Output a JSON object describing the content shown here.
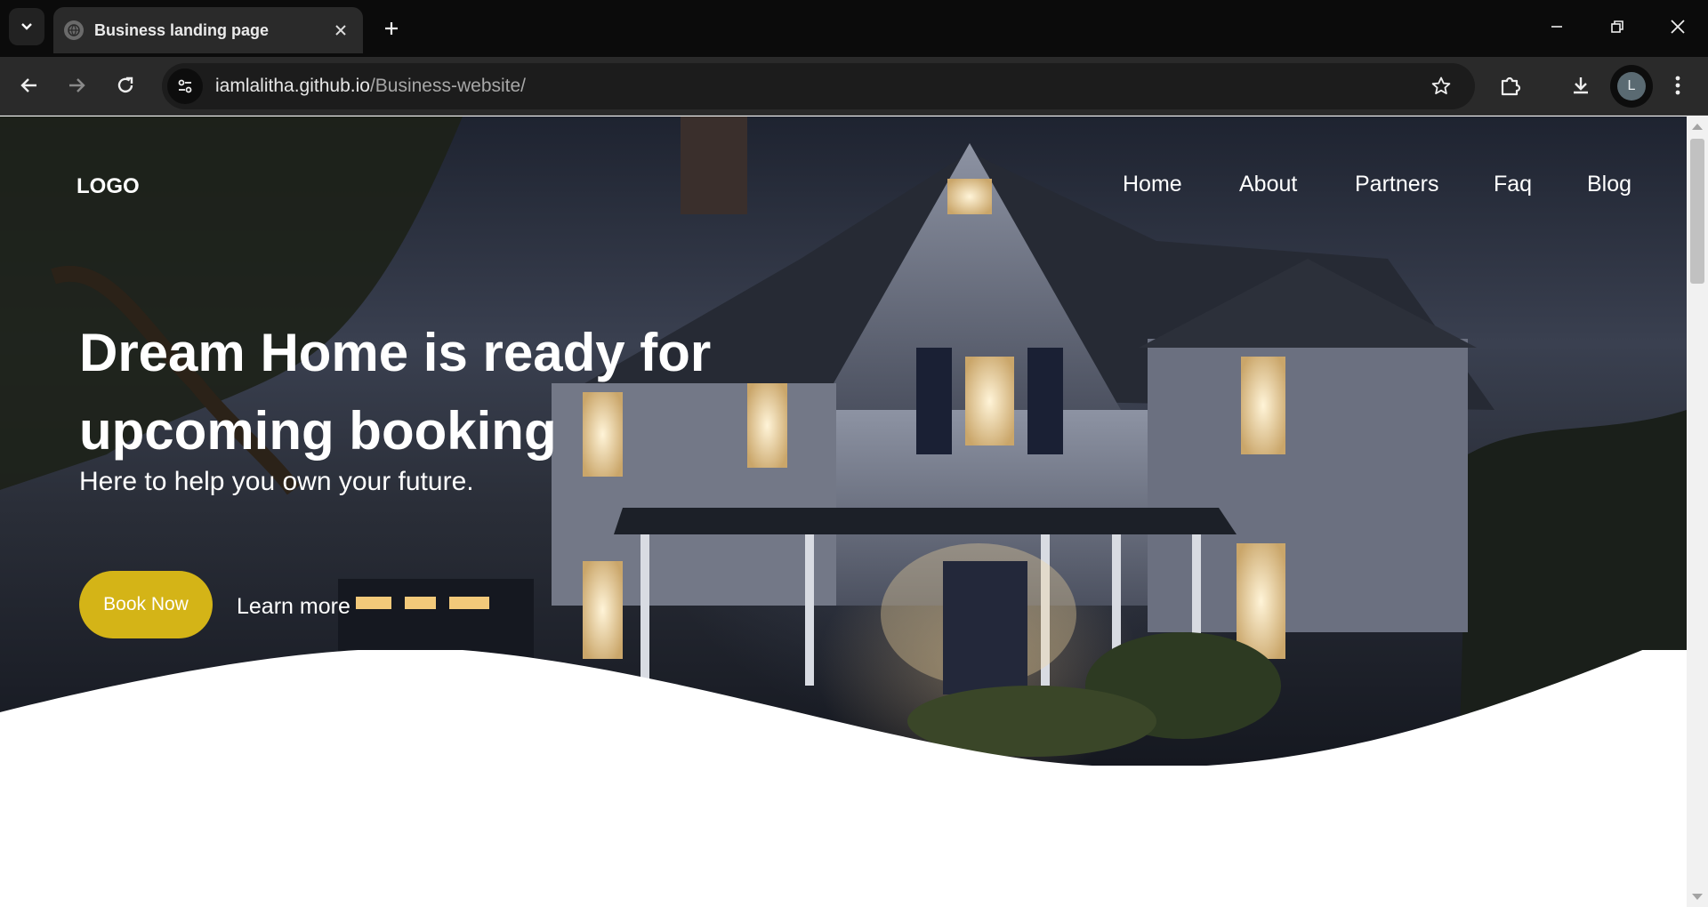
{
  "browser": {
    "tab": {
      "title": "Business landing page"
    },
    "url": {
      "host": "iamlalitha.github.io",
      "path": "/Business-website/"
    },
    "profile_initial": "L"
  },
  "icons": {
    "tab_search": "chevron-down-icon",
    "tab_close": "close-icon",
    "new_tab": "plus-icon",
    "minimize": "minimize-icon",
    "restore": "restore-icon",
    "close_window": "close-icon",
    "back": "arrow-left-icon",
    "forward": "arrow-right-icon",
    "reload": "reload-icon",
    "site_info": "tune-icon",
    "bookmark": "star-icon",
    "extensions": "puzzle-icon",
    "downloads": "download-icon",
    "menu": "more-vertical-icon"
  },
  "page": {
    "logo": "LOGO",
    "nav": [
      "Home",
      "About",
      "Partners",
      "Faq",
      "Blog"
    ],
    "hero": {
      "headline": "Dream Home is ready for upcoming booking",
      "subheadline": "Here to help you own your future.",
      "primary_cta": "Book Now",
      "secondary_cta": "Learn more"
    }
  },
  "colors": {
    "accent": "#d4b417",
    "chrome_bg": "#0b0b0b",
    "toolbar_bg": "#2a2a2a"
  }
}
